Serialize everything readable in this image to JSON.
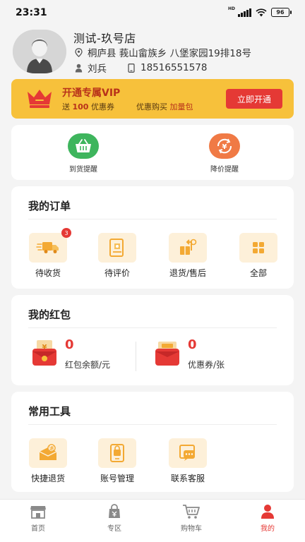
{
  "status_bar": {
    "time": "23:31",
    "network": "HD",
    "battery": "96"
  },
  "profile": {
    "store_name": "测试-玖号店",
    "address": "桐庐县  莪山畲族乡  八堡家园19排18号",
    "contact_name": "刘兵",
    "phone": "18516551578"
  },
  "vip": {
    "title": "开通专属VIP",
    "gift_prefix": "送",
    "gift_count": "100",
    "gift_suffix": "优惠券",
    "purchase_text": "优惠购买",
    "purchase_pack": "加量包",
    "button": "立即开通"
  },
  "reminders": [
    {
      "label": "到货提醒",
      "icon": "basket-icon",
      "color": "#3eb55d"
    },
    {
      "label": "降价提醒",
      "icon": "price-drop-icon",
      "color": "#f07a45"
    }
  ],
  "orders": {
    "title": "我的订单",
    "items": [
      {
        "label": "待收货",
        "icon": "delivery-truck-icon",
        "badge": "3"
      },
      {
        "label": "待评价",
        "icon": "review-icon"
      },
      {
        "label": "退货/售后",
        "icon": "return-icon"
      },
      {
        "label": "全部",
        "icon": "grid-icon"
      }
    ]
  },
  "red_packets": {
    "title": "我的红包",
    "balance": {
      "value": "0",
      "label": "红包余额/元"
    },
    "coupons": {
      "value": "0",
      "label": "优惠券/张"
    }
  },
  "tools": {
    "title": "常用工具",
    "items": [
      {
        "label": "快捷退货",
        "icon": "quick-return-icon"
      },
      {
        "label": "账号管理",
        "icon": "account-icon"
      },
      {
        "label": "联系客服",
        "icon": "customer-service-icon"
      }
    ]
  },
  "tabbar": [
    {
      "label": "首页",
      "icon": "store-icon",
      "active": false
    },
    {
      "label": "专区",
      "icon": "bag-icon",
      "active": false
    },
    {
      "label": "购物车",
      "icon": "cart-icon",
      "active": false
    },
    {
      "label": "我的",
      "icon": "person-icon",
      "active": true
    }
  ],
  "colors": {
    "accent": "#e53935",
    "vip_bg": "#f7c13b",
    "tile_bg": "#fdf0d9"
  }
}
